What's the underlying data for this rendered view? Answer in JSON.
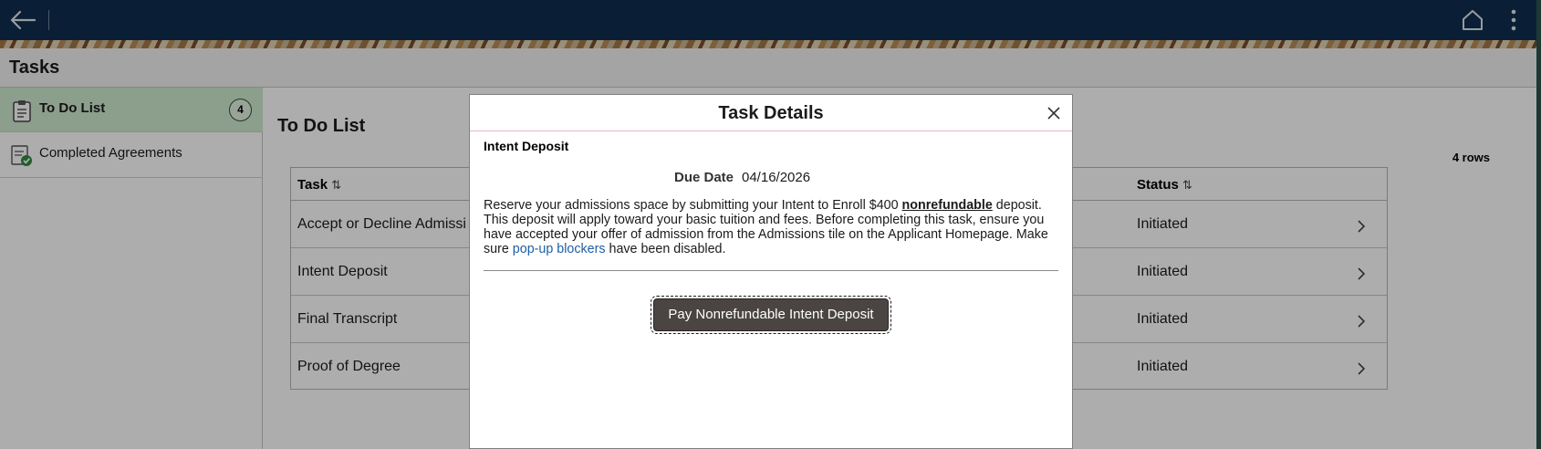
{
  "page": {
    "title": "Tasks"
  },
  "sidebar": {
    "items": [
      {
        "label": "To Do List",
        "badge": "4",
        "icon": "clipboard-icon"
      },
      {
        "label": "Completed Agreements",
        "icon": "checked-list-icon"
      }
    ]
  },
  "main": {
    "title": "To Do List",
    "rows_count": "4 rows",
    "columns": {
      "task": "Task",
      "status": "Status"
    },
    "rows": [
      {
        "task": "Accept or Decline Admissi",
        "status": "Initiated"
      },
      {
        "task": "Intent Deposit",
        "status": "Initiated"
      },
      {
        "task": "Final Transcript",
        "status": "Initiated"
      },
      {
        "task": "Proof of Degree",
        "status": "Initiated"
      }
    ]
  },
  "modal": {
    "title": "Task Details",
    "section_title": "Intent Deposit",
    "due_label": "Due Date",
    "due_value": "04/16/2026",
    "desc_part1": "Reserve your admissions space by submitting your Intent to Enroll $400 ",
    "desc_bold": "nonrefundable",
    "desc_part2": " deposit. This deposit will apply toward your basic tuition and fees. Before completing this task, ensure you have accepted your offer of admission from the Admissions tile on the Applicant Homepage.  Make sure ",
    "desc_link": "pop-up blockers",
    "desc_part3": " have been disabled.",
    "button_label": "Pay Nonrefundable Intent Deposit"
  },
  "colors": {
    "header": "#0f2f4f",
    "active_nav": "#cfe9cf",
    "button": "#4a4542",
    "link": "#1f5fa3"
  }
}
